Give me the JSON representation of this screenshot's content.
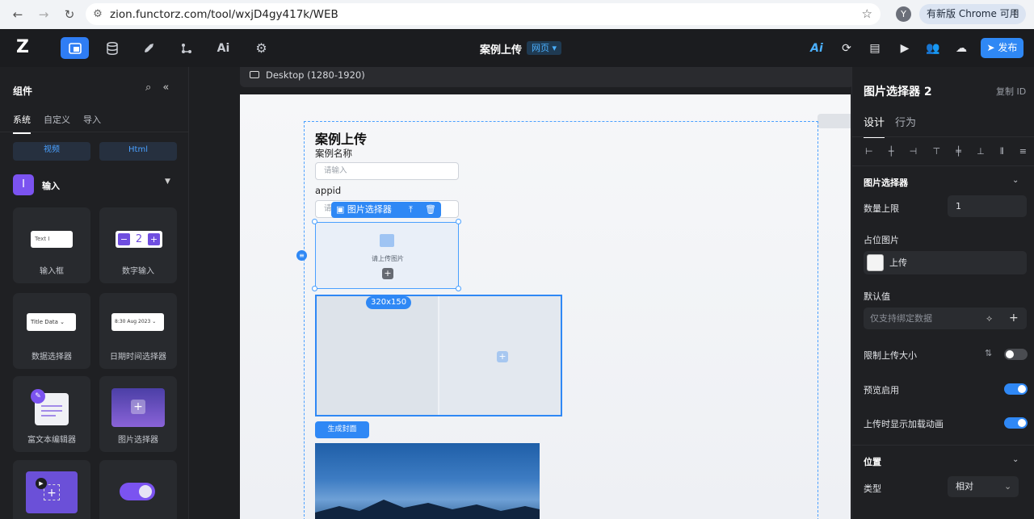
{
  "browser": {
    "url": "zion.functorz.com/tool/wxjD4gy417k/WEB",
    "profile_initial": "Y",
    "update_label": "有新版 Chrome 可用"
  },
  "topbar": {
    "project_title": "案例上传",
    "project_tag": "网页",
    "publish_label": "发布"
  },
  "left_panel": {
    "title": "组件",
    "tabs": [
      "系统",
      "自定义",
      "导入"
    ],
    "chips": [
      "视频",
      "Html"
    ],
    "group_label": "输入",
    "cards": [
      {
        "label": "输入框",
        "preview": "Text"
      },
      {
        "label": "数字输入",
        "preview": "2"
      },
      {
        "label": "数据选择器",
        "preview": "Title  Data"
      },
      {
        "label": "日期时间选择器",
        "preview": "8:30  Aug 2023"
      },
      {
        "label": "富文本编辑器",
        "preview": ""
      },
      {
        "label": "图片选择器",
        "preview": ""
      }
    ]
  },
  "canvas": {
    "device_label": "Desktop (1280-1920)",
    "page_title": "案例上传",
    "field1_label": "案例名称",
    "field1_placeholder": "请输入",
    "field2_label": "appid",
    "field2_placeholder": "请",
    "selected_tag": "图片选择器",
    "uploader_text": "请上传图片",
    "size_tag": "320x150",
    "gen_button": "生成封面"
  },
  "right_panel": {
    "title": "图片选择器 2",
    "copy_id": "复制 ID",
    "tab_design": "设计",
    "tab_behavior": "行为",
    "section_picker": "图片选择器",
    "max_count_label": "数量上限",
    "max_count_value": "1",
    "placeholder_img_label": "占位图片",
    "upload_label": "上传",
    "default_label": "默认值",
    "default_placeholder": "仅支持绑定数据",
    "limit_size_label": "限制上传大小",
    "limit_size_on": false,
    "preview_label": "预览启用",
    "preview_on": true,
    "loading_anim_label": "上传时显示加载动画",
    "loading_anim_on": true,
    "section_position": "位置",
    "type_label": "类型",
    "type_value": "相对"
  }
}
